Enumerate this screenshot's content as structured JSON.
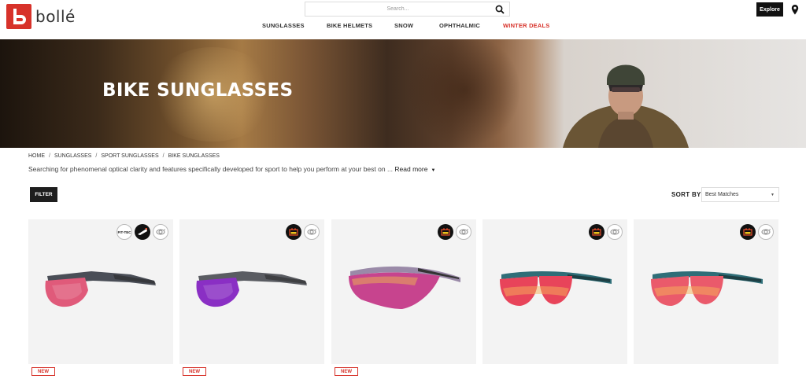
{
  "brand": {
    "name": "bollé",
    "accent": "#d7322a"
  },
  "search": {
    "placeholder": "Search..."
  },
  "nav": {
    "items": [
      "SUNGLASSES",
      "BIKE HELMETS",
      "SNOW",
      "OPHTHALMIC",
      "WINTER DEALS"
    ]
  },
  "header": {
    "explore_label": "Explore",
    "location_icon": "map-pin-icon"
  },
  "hero": {
    "title": "BIKE SUNGLASSES"
  },
  "breadcrumb": [
    "HOME",
    "SUNGLASSES",
    "SPORT SUNGLASSES",
    "BIKE SUNGLASSES"
  ],
  "description": {
    "text": "Searching for phenomenal optical clarity and features specifically developed for sport to help you perform at your best on ...",
    "read_more": "Read more"
  },
  "toolbar": {
    "filter_label": "FILTER",
    "sort_label": "SORT BY",
    "sort_value": "Best Matches"
  },
  "products": [
    {
      "badges": [
        "FIT-TEC",
        "lens-tech-icon",
        "360-view-icon"
      ],
      "new_label": "NEW",
      "frame": "#4a4e57",
      "lens": "#e05a7a"
    },
    {
      "badges": [
        "lens-battery-icon",
        "360-view-icon"
      ],
      "new_label": "NEW",
      "frame": "#5a5c62",
      "lens": "#8a2fc4"
    },
    {
      "badges": [
        "lens-battery-icon",
        "360-view-icon"
      ],
      "new_label": "NEW",
      "frame": "#9a8aa8",
      "lens": "#c7448e"
    },
    {
      "badges": [
        "lens-battery-icon",
        "360-view-icon"
      ],
      "new_label": "",
      "frame": "#2f6e78",
      "lens": "#e8445a"
    },
    {
      "badges": [
        "lens-battery-icon",
        "360-view-icon"
      ],
      "new_label": "",
      "frame": "#2f6e78",
      "lens": "#ea5a6b"
    }
  ]
}
